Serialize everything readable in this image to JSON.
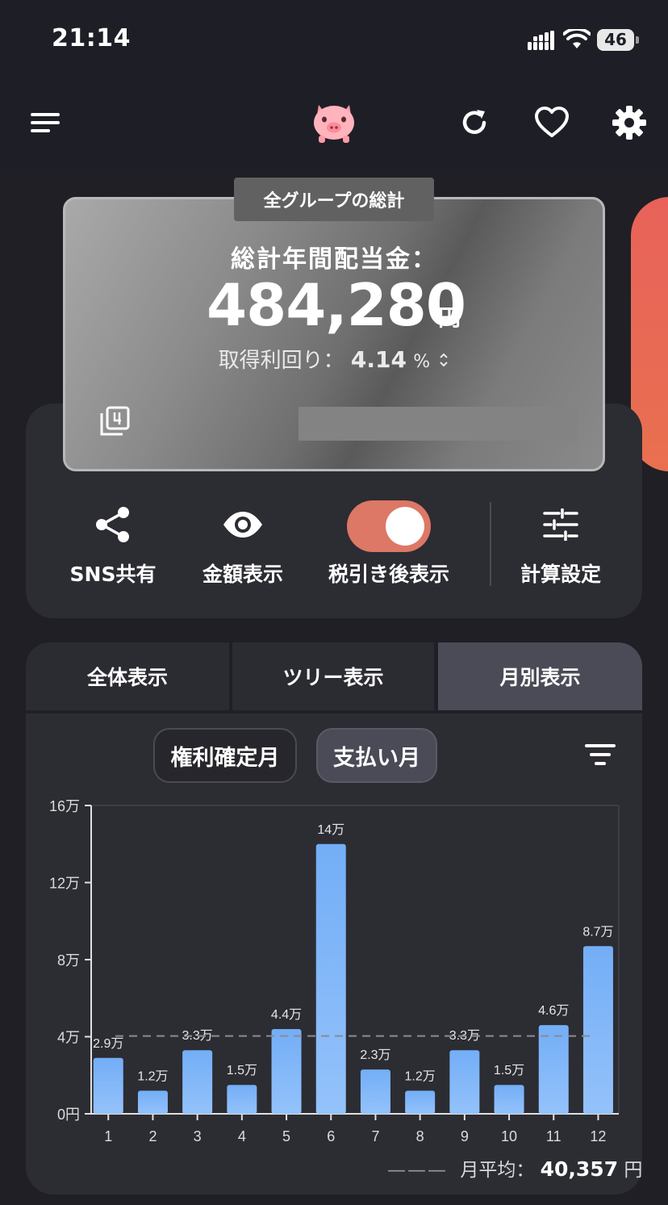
{
  "status": {
    "time": "21:14",
    "battery": "46"
  },
  "header": {
    "menu_icon": "menu-icon",
    "logo_icon": "piggy-bank-icon",
    "refresh_icon": "refresh-icon",
    "favorite_icon": "heart-icon",
    "settings_icon": "gear-icon"
  },
  "card": {
    "tag": "全グループの総計",
    "title": "総計年間配当金：",
    "amount": "484,280",
    "unit": "円",
    "yield_label": "取得利回り：",
    "yield_value": "4.14",
    "yield_unit": "%",
    "sort_icon": "chevron-updown-icon",
    "stack_icon": "stack-4-icon"
  },
  "actions": [
    {
      "label": "SNS共有",
      "icon": "share-icon"
    },
    {
      "label": "金額表示",
      "icon": "eye-icon"
    },
    {
      "label": "税引き後表示",
      "icon": "toggle-on-icon",
      "toggle_on": true
    },
    {
      "label": "計算設定",
      "icon": "sliders-icon"
    }
  ],
  "tabs": [
    {
      "label": "全体表示",
      "active": false
    },
    {
      "label": "ツリー表示",
      "active": false
    },
    {
      "label": "月別表示",
      "active": true
    }
  ],
  "filters": {
    "rights_month": "権利確定月",
    "payment_month": "支払い月",
    "selected": "支払い月",
    "filter_icon": "filter-icon"
  },
  "colors": {
    "accent": "#e8625a",
    "bar": "#73aef6",
    "background": "#1f1f25",
    "panel": "#2c2c33"
  },
  "chart_data": {
    "type": "bar",
    "categories": [
      "1",
      "2",
      "3",
      "4",
      "5",
      "6",
      "7",
      "8",
      "9",
      "10",
      "11",
      "12"
    ],
    "values": [
      29000,
      12000,
      33000,
      15000,
      44000,
      140000,
      23000,
      12000,
      33000,
      15000,
      46000,
      87000
    ],
    "data_labels": [
      "2.9万",
      "1.2万",
      "3.3万",
      "1.5万",
      "4.4万",
      "14万",
      "2.3万",
      "1.2万",
      "3.3万",
      "1.5万",
      "4.6万",
      "8.7万"
    ],
    "y_ticks": [
      0,
      40000,
      80000,
      120000,
      160000
    ],
    "y_tick_labels": [
      "0円",
      "4万",
      "8万",
      "12万",
      "16万"
    ],
    "ylim": [
      0,
      160000
    ],
    "average": 40357,
    "grid": false
  },
  "average": {
    "label": "月平均：",
    "value": "40,357",
    "unit": "円"
  }
}
